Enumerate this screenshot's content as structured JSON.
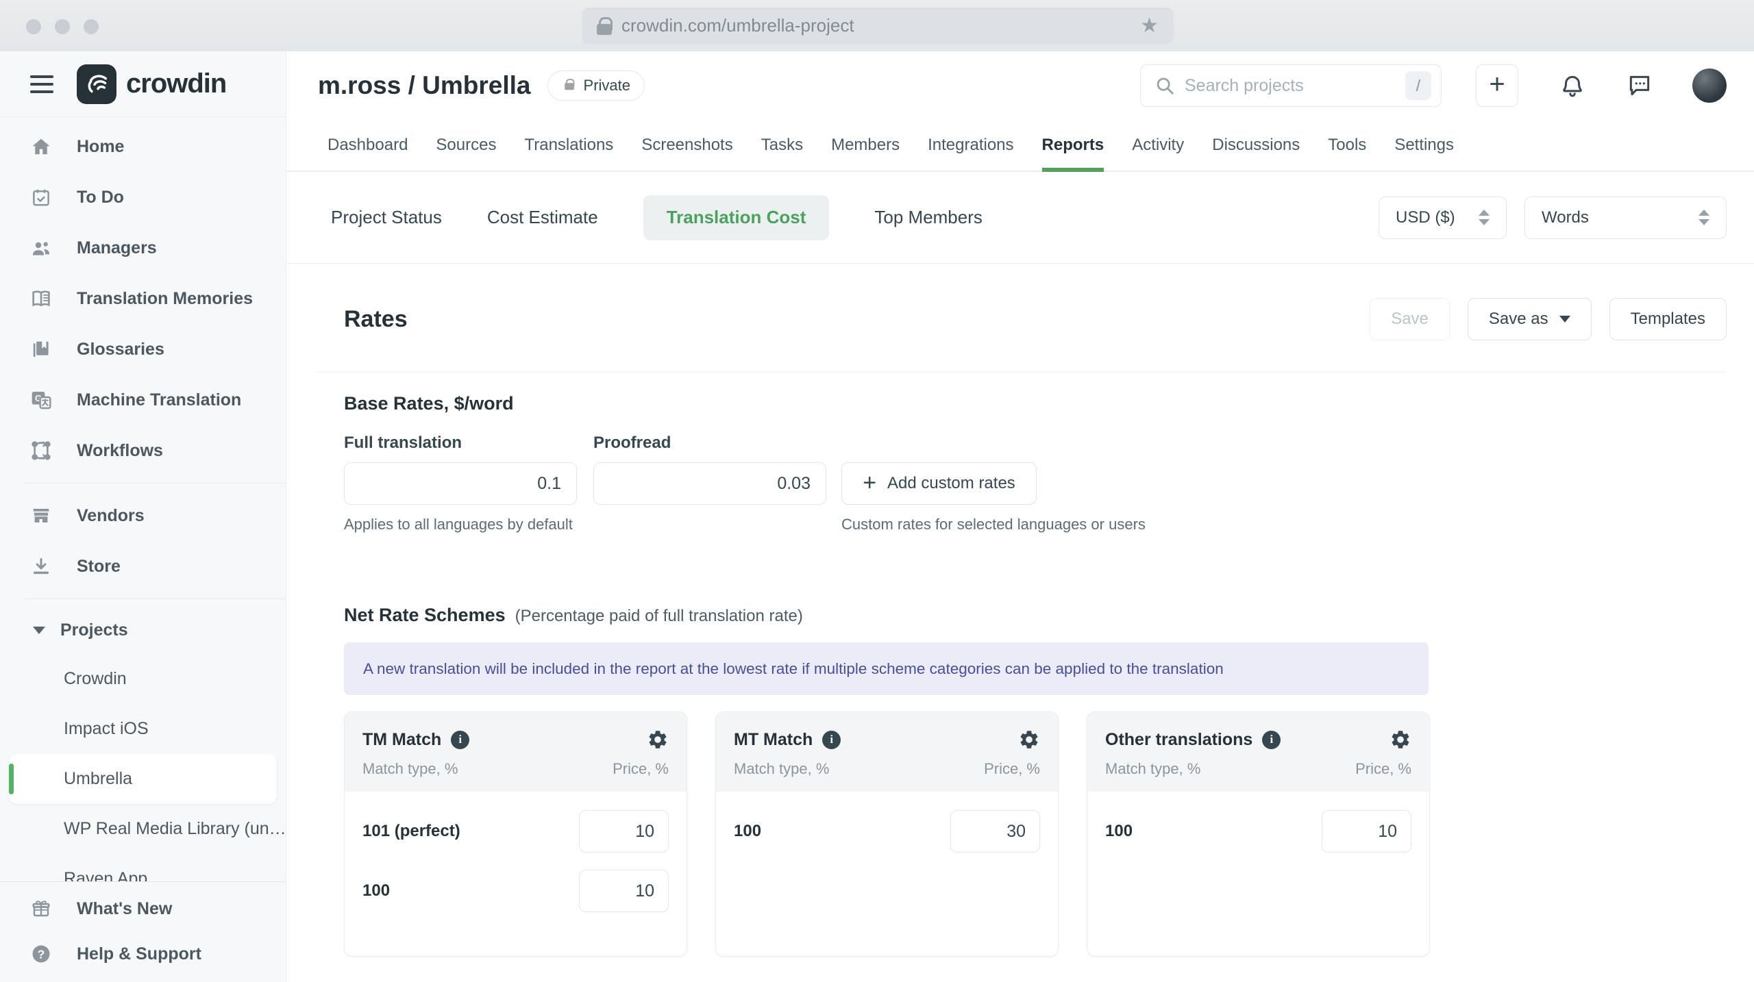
{
  "browser": {
    "url": "crowdin.com/umbrella-project"
  },
  "sidebar": {
    "logo_text": "crowdin",
    "primary": [
      {
        "label": "Home",
        "icon": "home-icon"
      },
      {
        "label": "To Do",
        "icon": "todo-calendar-icon"
      },
      {
        "label": "Managers",
        "icon": "managers-people-icon"
      },
      {
        "label": "Translation Memories",
        "icon": "open-book-icon"
      },
      {
        "label": "Glossaries",
        "icon": "glossary-book-icon"
      },
      {
        "label": "Machine Translation",
        "icon": "machine-translation-icon"
      },
      {
        "label": "Workflows",
        "icon": "workflow-nodes-icon"
      }
    ],
    "secondary": [
      {
        "label": "Vendors",
        "icon": "storefront-icon"
      },
      {
        "label": "Store",
        "icon": "download-icon"
      }
    ],
    "projects": {
      "header": "Projects",
      "items": [
        {
          "label": "Crowdin",
          "selected": false
        },
        {
          "label": "Impact iOS",
          "selected": false
        },
        {
          "label": "Umbrella",
          "selected": true
        },
        {
          "label": "WP Real Media Library (un…",
          "selected": false
        },
        {
          "label": "Raven App",
          "selected": false
        }
      ]
    },
    "footer": [
      {
        "label": "What's New",
        "icon": "gift-icon"
      },
      {
        "label": "Help & Support",
        "icon": "question-circle-icon"
      }
    ]
  },
  "header": {
    "breadcrumb": "m.ross / Umbrella",
    "privacy_badge": "Private",
    "search_placeholder": "Search projects",
    "search_shortcut": "/"
  },
  "tabs": {
    "active": "Reports",
    "items": [
      {
        "label": "Dashboard"
      },
      {
        "label": "Sources"
      },
      {
        "label": "Translations"
      },
      {
        "label": "Screenshots"
      },
      {
        "label": "Tasks"
      },
      {
        "label": "Members"
      },
      {
        "label": "Integrations"
      },
      {
        "label": "Reports"
      },
      {
        "label": "Activity"
      },
      {
        "label": "Discussions"
      },
      {
        "label": "Tools"
      },
      {
        "label": "Settings"
      }
    ]
  },
  "subtabs": {
    "active": "Translation Cost",
    "items": [
      {
        "label": "Project Status"
      },
      {
        "label": "Cost Estimate"
      },
      {
        "label": "Translation Cost"
      },
      {
        "label": "Top Members"
      }
    ]
  },
  "filters": {
    "currency": "USD ($)",
    "unit": "Words"
  },
  "rates": {
    "title": "Rates",
    "buttons": {
      "save": "Save",
      "save_as": "Save as",
      "templates": "Templates"
    },
    "base": {
      "heading": "Base Rates, $/word",
      "full_label": "Full translation",
      "full_value": "0.1",
      "proofread_label": "Proofread",
      "proofread_value": "0.03",
      "add_custom": "Add custom rates",
      "full_hint": "Applies to all languages by default",
      "custom_hint": "Custom rates for selected languages or users"
    },
    "net": {
      "heading": "Net Rate Schemes",
      "subheading": "(Percentage paid of full translation rate)",
      "banner": "A new translation will be included in the report at the lowest rate if multiple scheme categories can be applied to the translation",
      "cards": [
        {
          "title": "TM Match",
          "col_match": "Match type, %",
          "col_price": "Price, %",
          "rows": [
            {
              "match": "101 (perfect)",
              "price": "10"
            },
            {
              "match": "100",
              "price": "10"
            }
          ]
        },
        {
          "title": "MT Match",
          "col_match": "Match type, %",
          "col_price": "Price, %",
          "rows": [
            {
              "match": "100",
              "price": "30"
            }
          ]
        },
        {
          "title": "Other translations",
          "col_match": "Match type, %",
          "col_price": "Price, %",
          "rows": [
            {
              "match": "100",
              "price": "10"
            }
          ]
        }
      ]
    }
  },
  "colors": {
    "accent_green": "#53a158",
    "active_subtab_green": "#4ba25f",
    "selected_project_green": "#55b264",
    "banner_bg": "#ebecf8",
    "banner_text": "#4a4d9b",
    "heading_dark": "#263238"
  }
}
